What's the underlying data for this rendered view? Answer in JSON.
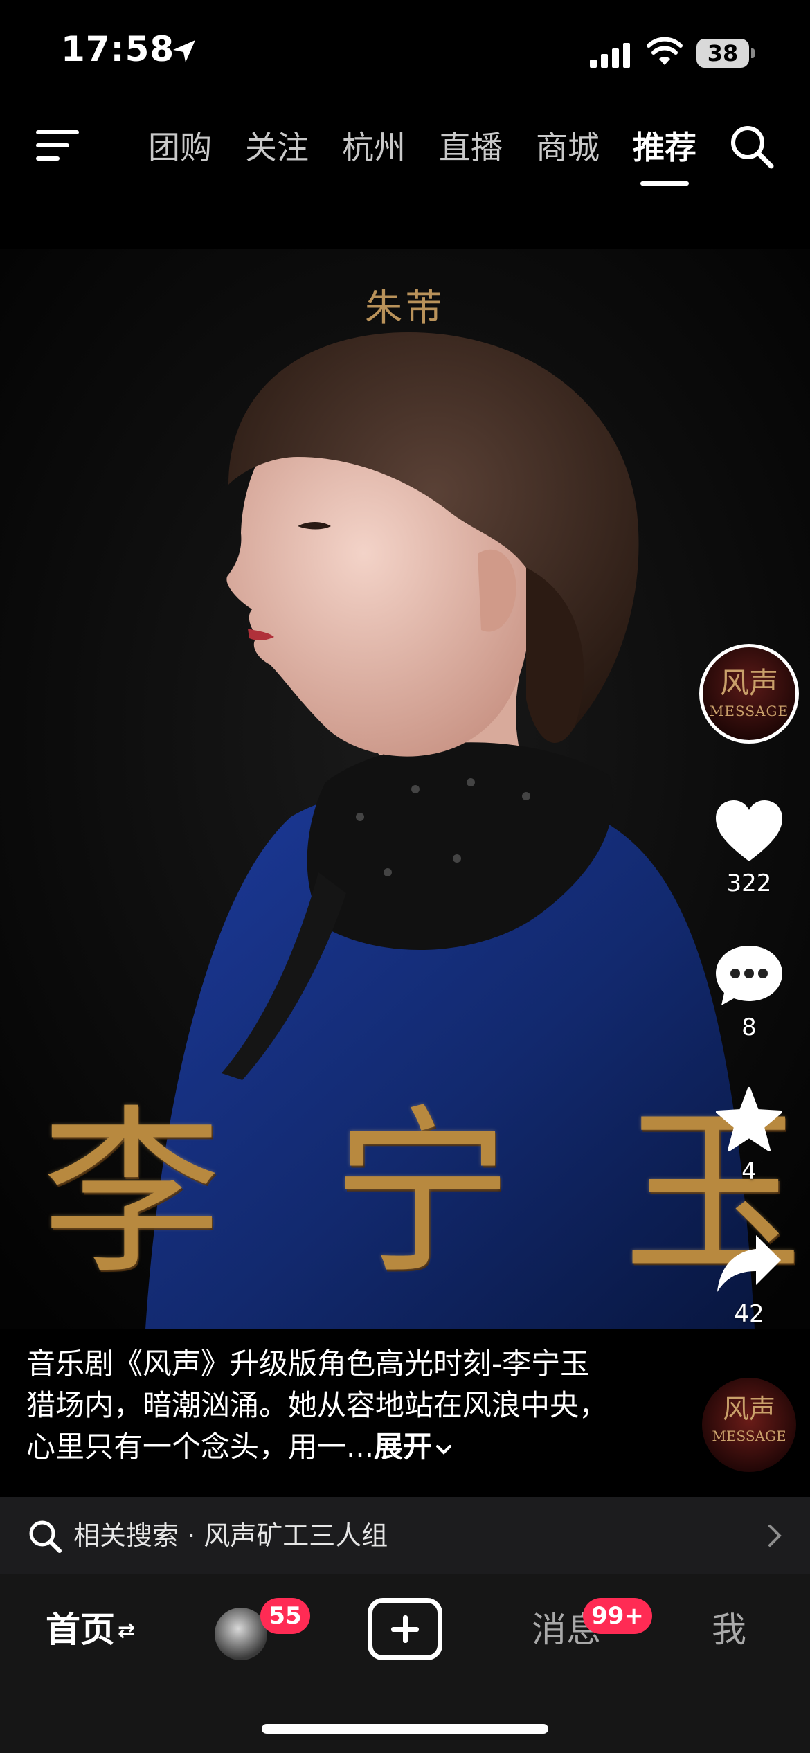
{
  "status_bar": {
    "time": "17:58",
    "battery": "38"
  },
  "top_nav": {
    "tabs": [
      {
        "label": "团购",
        "active": false
      },
      {
        "label": "关注",
        "active": false
      },
      {
        "label": "杭州",
        "active": false
      },
      {
        "label": "直播",
        "active": false
      },
      {
        "label": "商城",
        "active": false
      },
      {
        "label": "推荐",
        "active": true
      }
    ]
  },
  "video": {
    "credit": "朱芾",
    "title_chars": [
      "李",
      "宁",
      "玉"
    ]
  },
  "actions": {
    "avatar_title": "风声",
    "avatar_subtitle": "MESSAGE",
    "likes": "322",
    "comments": "8",
    "favorites": "4",
    "shares": "42"
  },
  "caption": {
    "text": "音乐剧《风声》升级版角色高光时刻-李宁玉 猎场内，暗潮汹涌。她从容地站在风浪中央，心里只有一个念头，用一...",
    "expand": "展开"
  },
  "related_search": {
    "text": "相关搜索 · 风声矿工三人组"
  },
  "bottom_nav": {
    "home": "首页",
    "home_arrows": "⇄",
    "friends_badge": "55",
    "messages": "消息",
    "messages_badge": "99+",
    "me": "我"
  },
  "colors": {
    "accent_badge": "#ff2b54",
    "gold": "#b8893f",
    "velvet_blue": "#12296e"
  }
}
